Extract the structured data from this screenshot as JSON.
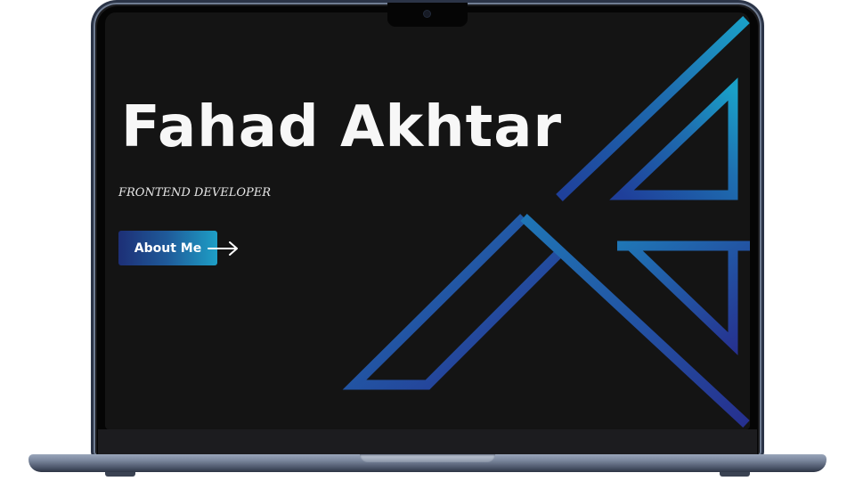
{
  "hero": {
    "name": "Fahad Akhtar",
    "role": "FRONTEND DEVELOPER",
    "cta_label": "About Me"
  },
  "icons": {
    "cta_arrow": "arrow-right-icon",
    "camera": "camera-icon",
    "logo": "angular-logo-mark"
  },
  "colors": {
    "background": "#141414",
    "heading": "#f7f7f7",
    "accent_start": "#1d2f76",
    "accent_end": "#1e9fc6"
  }
}
